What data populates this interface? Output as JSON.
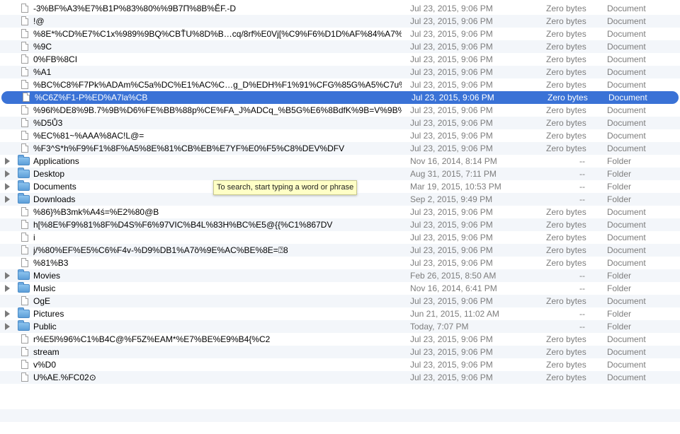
{
  "rows": [
    {
      "name": "-3%BF%A3%E7%B1P%83%80%%9B7П%8B%ĔF.-D",
      "date": "Jul 23, 2015, 9:06 PM",
      "size": "Zero bytes",
      "kind": "Document",
      "icon": "document-icon",
      "folder": false
    },
    {
      "name": "!@",
      "date": "Jul 23, 2015, 9:06 PM",
      "size": "Zero bytes",
      "kind": "Document",
      "icon": "document-icon",
      "folder": false
    },
    {
      "name": "%8E*%CD%E7%C1x%989%9BQ%CBŤU%8D%B…cq/8rf%E0Vj[%C9%F6%D1D%AF%84%A7%C0",
      "date": "Jul 23, 2015, 9:06 PM",
      "size": "Zero bytes",
      "kind": "Document",
      "icon": "document-icon",
      "folder": false
    },
    {
      "name": "%9C",
      "date": "Jul 23, 2015, 9:06 PM",
      "size": "Zero bytes",
      "kind": "Document",
      "icon": "document-icon",
      "folder": false
    },
    {
      "name": "0%FB%8CI",
      "date": "Jul 23, 2015, 9:06 PM",
      "size": "Zero bytes",
      "kind": "Document",
      "icon": "document-icon",
      "folder": false
    },
    {
      "name": "%A1",
      "date": "Jul 23, 2015, 9:06 PM",
      "size": "Zero bytes",
      "kind": "Document",
      "icon": "document-icon",
      "folder": false
    },
    {
      "name": "%BC%C8%F7Pk%ADAm%C5a%DC%E1%AC%C…g_D%EDH%F1%91%CFG%85G%A5%C7u%D5",
      "date": "Jul 23, 2015, 9:06 PM",
      "size": "Zero bytes",
      "kind": "Document",
      "icon": "document-icon",
      "folder": false
    },
    {
      "name": "%C6Z%F1-P%ED%A7la%CB",
      "date": "Jul 23, 2015, 9:06 PM",
      "size": "Zero bytes",
      "kind": "Document",
      "icon": "document-icon",
      "folder": false,
      "selected": true
    },
    {
      "name": "%96l%DE8%9B.7%9B%D6%FE%BB%88p%CE%FA_J%ADCq_%B5G%E6%8BdfK%9B=V%9B%9B%FE",
      "date": "Jul 23, 2015, 9:06 PM",
      "size": "Zero bytes",
      "kind": "Document",
      "icon": "document-icon",
      "folder": false
    },
    {
      "name": "%D5Ů3",
      "date": "Jul 23, 2015, 9:06 PM",
      "size": "Zero bytes",
      "kind": "Document",
      "icon": "document-icon",
      "folder": false
    },
    {
      "name": "%EC%81~%AAA%8AC!L@=",
      "date": "Jul 23, 2015, 9:06 PM",
      "size": "Zero bytes",
      "kind": "Document",
      "icon": "document-icon",
      "folder": false
    },
    {
      "name": "%F3^S*h%F9%F1%8F%A5%8E%81%CB%EB%E7YF%E0%F5%C8%DEV%DFV",
      "date": "Jul 23, 2015, 9:06 PM",
      "size": "Zero bytes",
      "kind": "Document",
      "icon": "document-icon",
      "folder": false
    },
    {
      "name": "Applications",
      "date": "Nov 16, 2014, 8:14 PM",
      "size": "--",
      "kind": "Folder",
      "icon": "folder-icon",
      "folder": true
    },
    {
      "name": "Desktop",
      "date": "Aug 31, 2015, 7:11 PM",
      "size": "--",
      "kind": "Folder",
      "icon": "folder-icon",
      "folder": true
    },
    {
      "name": "Documents",
      "date": "Mar 19, 2015, 10:53 PM",
      "size": "--",
      "kind": "Folder",
      "icon": "folder-icon",
      "folder": true
    },
    {
      "name": "Downloads",
      "date": "Sep 2, 2015, 9:49 PM",
      "size": "--",
      "kind": "Folder",
      "icon": "folder-icon",
      "folder": true
    },
    {
      "name": "%86}%B3mk%A4ś=%E2%80@B",
      "date": "Jul 23, 2015, 9:06 PM",
      "size": "Zero bytes",
      "kind": "Document",
      "icon": "document-icon",
      "folder": false
    },
    {
      "name": "h[%8E%F9%81%8F%D4S%F6%97VIC%B4L%83H%BC%E5@{{%C1%867DV",
      "date": "Jul 23, 2015, 9:06 PM",
      "size": "Zero bytes",
      "kind": "Document",
      "icon": "document-icon",
      "folder": false
    },
    {
      "name": "i",
      "date": "Jul 23, 2015, 9:06 PM",
      "size": "Zero bytes",
      "kind": "Document",
      "icon": "document-icon",
      "folder": false
    },
    {
      "name": "j/%80%EF%E5%C6%F4v-%D9%DB1%A7ȍ%9E%AC%BE%8E=⍰8",
      "date": "Jul 23, 2015, 9:06 PM",
      "size": "Zero bytes",
      "kind": "Document",
      "icon": "document-icon",
      "folder": false
    },
    {
      "name": "%81%B3",
      "date": "Jul 23, 2015, 9:06 PM",
      "size": "Zero bytes",
      "kind": "Document",
      "icon": "document-icon",
      "folder": false
    },
    {
      "name": "Movies",
      "date": "Feb 26, 2015, 8:50 AM",
      "size": "--",
      "kind": "Folder",
      "icon": "folder-icon",
      "folder": true
    },
    {
      "name": "Music",
      "date": "Nov 16, 2014, 6:41 PM",
      "size": "--",
      "kind": "Folder",
      "icon": "folder-icon",
      "folder": true
    },
    {
      "name": "OgE",
      "date": "Jul 23, 2015, 9:06 PM",
      "size": "Zero bytes",
      "kind": "Document",
      "icon": "document-icon",
      "folder": false
    },
    {
      "name": "Pictures",
      "date": "Jun 21, 2015, 11:02 AM",
      "size": "--",
      "kind": "Folder",
      "icon": "folder-icon",
      "folder": true
    },
    {
      "name": "Public",
      "date": "Today, 7:07 PM",
      "size": "--",
      "kind": "Folder",
      "icon": "folder-icon",
      "folder": true
    },
    {
      "name": "r%E5l%96%C1%B4C@%F5Z%EAM*%E7%BE%E9%B4{%C2",
      "date": "Jul 23, 2015, 9:06 PM",
      "size": "Zero bytes",
      "kind": "Document",
      "icon": "document-icon",
      "folder": false
    },
    {
      "name": "stream",
      "date": "Jul 23, 2015, 9:06 PM",
      "size": "Zero bytes",
      "kind": "Document",
      "icon": "document-icon",
      "folder": false
    },
    {
      "name": "v%D0",
      "date": "Jul 23, 2015, 9:06 PM",
      "size": "Zero bytes",
      "kind": "Document",
      "icon": "document-icon",
      "folder": false
    },
    {
      "name": "U%AE.%FC02⊙",
      "date": "Jul 23, 2015, 9:06 PM",
      "size": "Zero bytes",
      "kind": "Document",
      "icon": "document-icon",
      "folder": false
    }
  ],
  "tooltip": {
    "text": "To search, start typing a word or phrase"
  },
  "colors": {
    "selection": "#3a72d6",
    "alt_row": "#f3f6fa",
    "secondary_text": "#7d7d7d",
    "tooltip_bg": "#ffffc6"
  }
}
